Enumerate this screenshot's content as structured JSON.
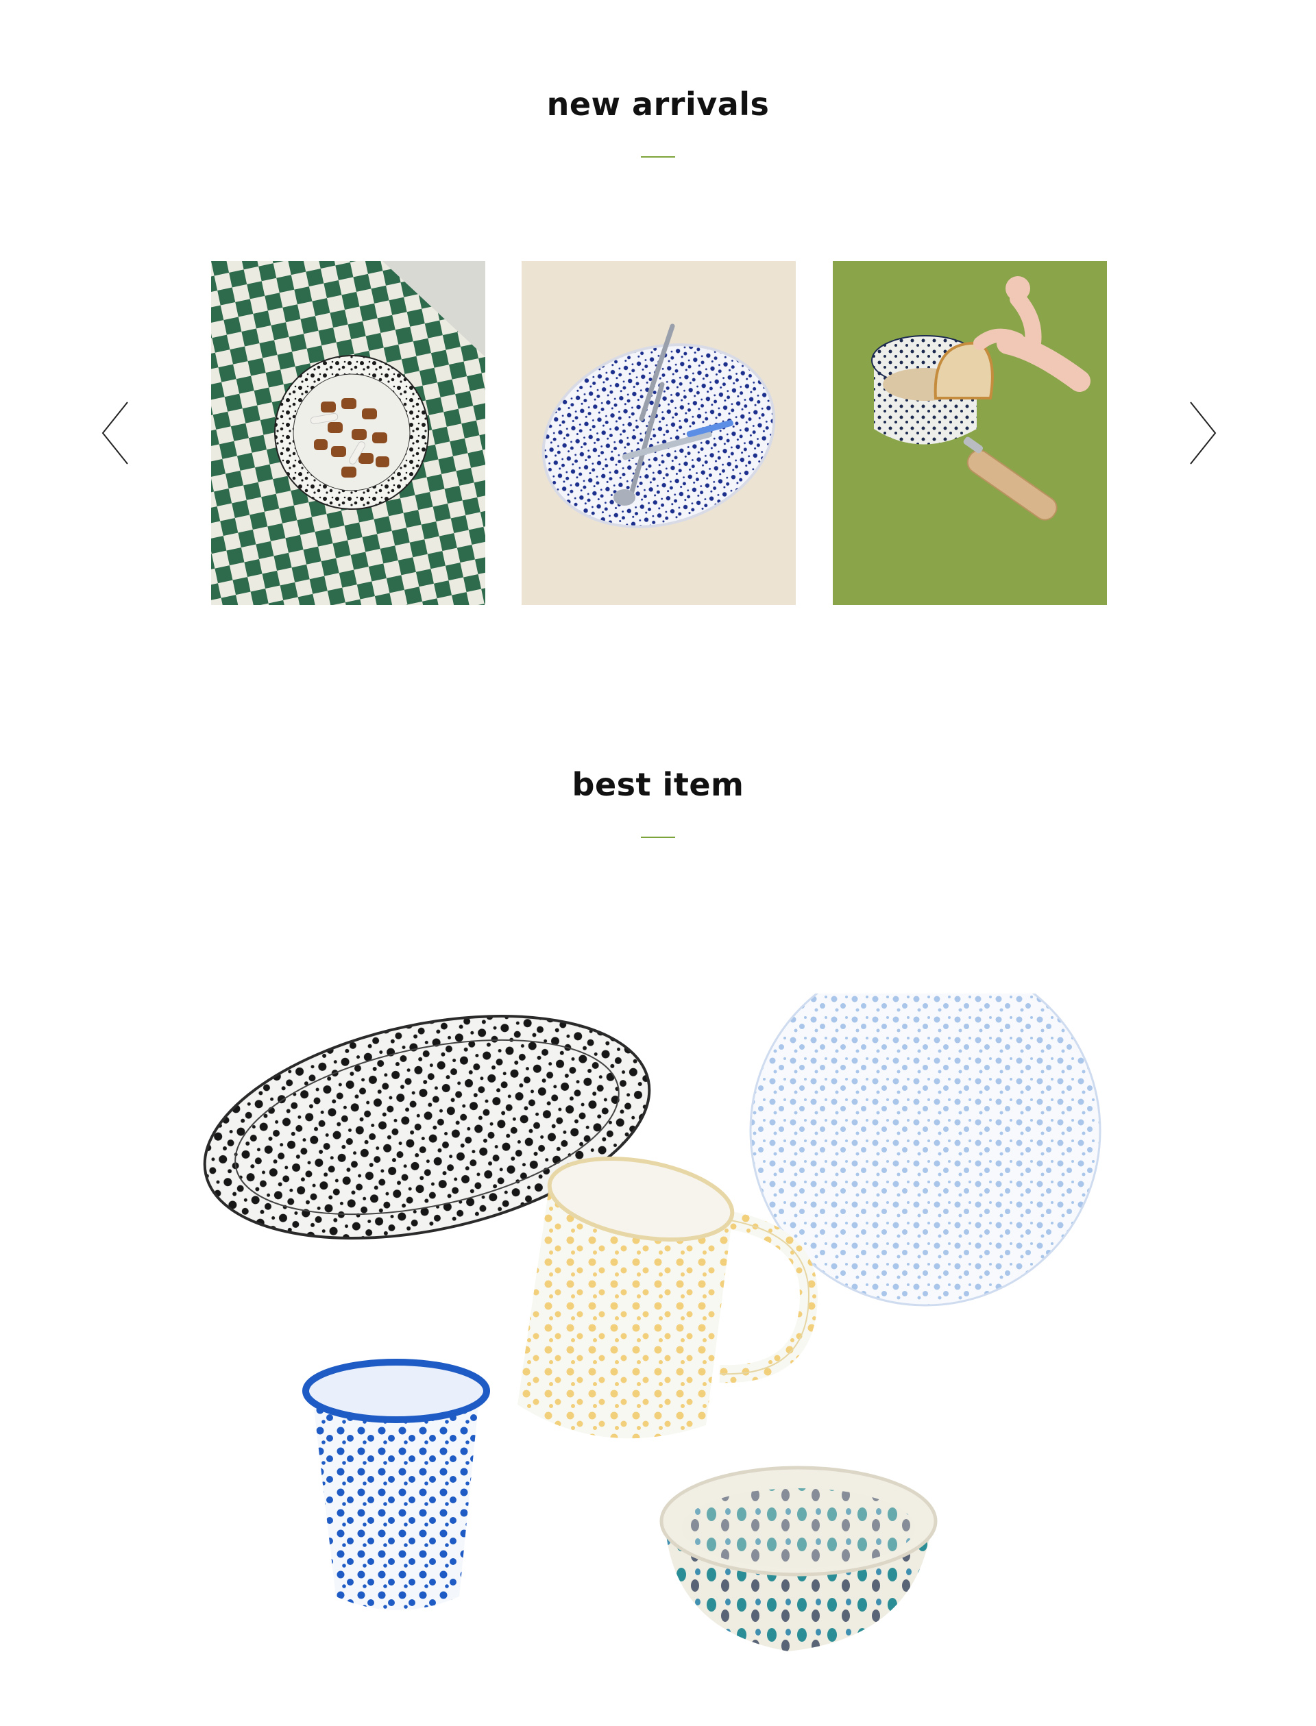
{
  "new_arrivals": {
    "title": "new arrivals",
    "prev_icon": "chevron-left-icon",
    "next_icon": "chevron-right-icon",
    "products": [
      {
        "image": "checkered-cloth-speckled-plate-image"
      },
      {
        "image": "blue-splatter-oval-plate-image"
      },
      {
        "image": "splatter-saucepan-bread-image"
      }
    ]
  },
  "best_item": {
    "title": "best item",
    "image": "enamelware-collection-image"
  },
  "colors": {
    "accent": "#7da33b",
    "heading": "#111111",
    "background": "#ffffff"
  }
}
